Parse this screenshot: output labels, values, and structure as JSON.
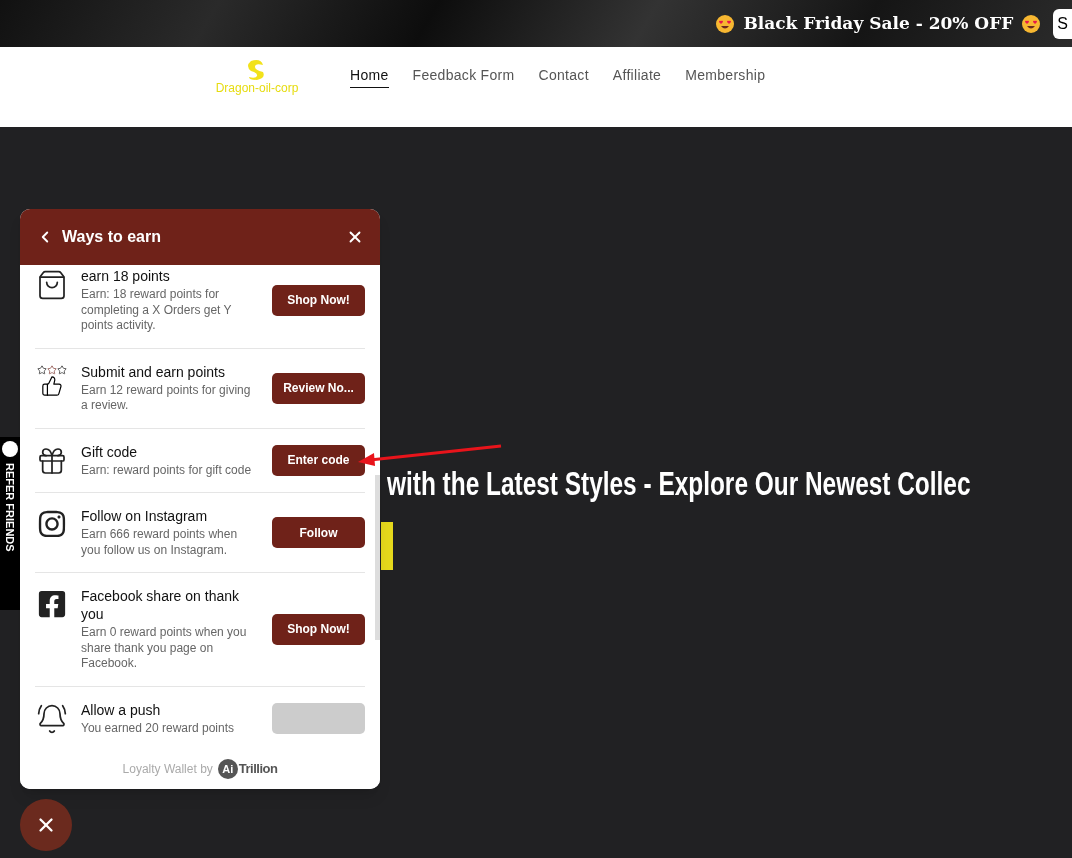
{
  "announcement_bar": {
    "text": "Black Friday Sale - 20% OFF",
    "corner_text": "S"
  },
  "header": {
    "logo_text": "Dragon-oil-corp",
    "nav": [
      {
        "label": "Home",
        "selected": true
      },
      {
        "label": "Feedback Form",
        "selected": false
      },
      {
        "label": "Contact",
        "selected": false
      },
      {
        "label": "Affiliate",
        "selected": false
      },
      {
        "label": "Membership",
        "selected": false
      }
    ]
  },
  "hero": {
    "heading": "with the Latest Styles - Explore Our Newest Collec"
  },
  "side_tab": {
    "label": "REFER FRIENDS"
  },
  "panel": {
    "title": "Ways to earn",
    "items": [
      {
        "kind": "bag",
        "title": "earn 18 points",
        "description": "Earn: 18 reward points for completing a X Orders get Y points activity.",
        "button": "Shop Now!",
        "disabled": false
      },
      {
        "kind": "review",
        "title": "Submit and earn points",
        "description": "Earn 12 reward points for giving a review.",
        "button": "Review No...",
        "disabled": false
      },
      {
        "kind": "gift",
        "title": "Gift code",
        "description": "Earn: reward points for gift code",
        "button": "Enter code",
        "disabled": false
      },
      {
        "kind": "instagram",
        "title": "Follow on Instagram",
        "description": "Earn 666 reward points when you follow us on Instagram.",
        "button": "Follow",
        "disabled": false
      },
      {
        "kind": "facebook",
        "title": "Facebook share on thank you",
        "description": "Earn 0 reward points when you share thank you page on Facebook.",
        "button": "Shop Now!",
        "disabled": false
      },
      {
        "kind": "push",
        "title": "Allow a push",
        "description": "You earned 20 reward points",
        "disabled": true
      }
    ],
    "footer": {
      "text": "Loyalty Wallet by",
      "brand_mark": "Ai",
      "brand": "Trillion"
    }
  }
}
